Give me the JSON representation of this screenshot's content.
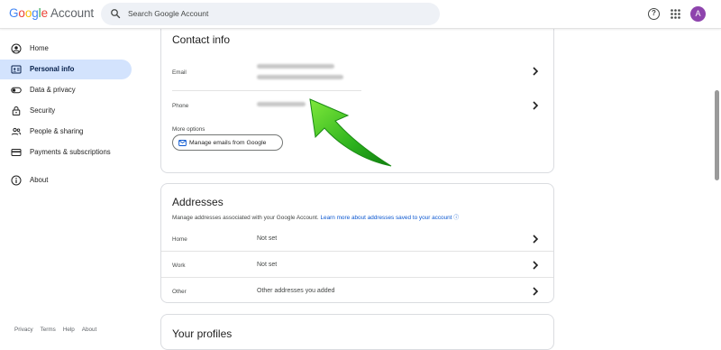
{
  "header": {
    "logo_letters": [
      "G",
      "o",
      "o",
      "g",
      "l",
      "e"
    ],
    "logo_suffix": "Account",
    "search_placeholder": "Search Google Account",
    "avatar_initial": "A",
    "colors": {
      "blue": "#4285f4",
      "red": "#ea4335",
      "yellow": "#fbbc05",
      "green": "#34a853",
      "avatar": "#8e44ad"
    }
  },
  "sidebar": {
    "items": [
      {
        "label": "Home",
        "icon": "account-circle-icon"
      },
      {
        "label": "Personal info",
        "icon": "id-card-icon",
        "active": true
      },
      {
        "label": "Data & privacy",
        "icon": "toggle-icon"
      },
      {
        "label": "Security",
        "icon": "lock-icon"
      },
      {
        "label": "People & sharing",
        "icon": "people-icon"
      },
      {
        "label": "Payments & subscriptions",
        "icon": "credit-card-icon"
      },
      {
        "label": "About",
        "icon": "info-icon"
      }
    ],
    "footer": [
      "Privacy",
      "Terms",
      "Help",
      "About"
    ]
  },
  "contact": {
    "title": "Contact info",
    "email_label": "Email",
    "phone_label": "Phone",
    "more_options": "More options",
    "manage_button": "Manage emails from Google"
  },
  "addresses": {
    "title": "Addresses",
    "subtitle": "Manage addresses associated with your Google Account.",
    "link": "Learn more about addresses saved to your account",
    "rows": [
      {
        "label": "Home",
        "value": "Not set"
      },
      {
        "label": "Work",
        "value": "Not set"
      },
      {
        "label": "Other",
        "value": "Other addresses you added"
      }
    ]
  },
  "profiles": {
    "title": "Your profiles"
  }
}
